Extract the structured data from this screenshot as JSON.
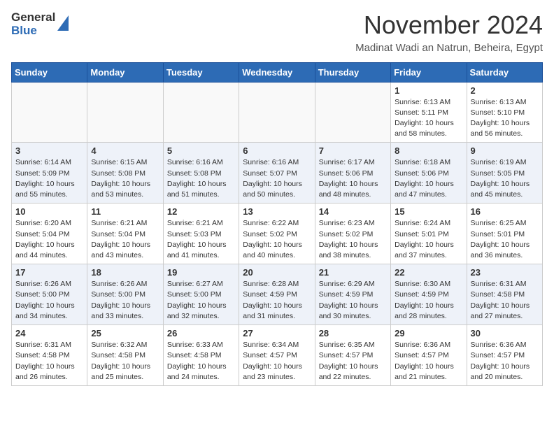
{
  "header": {
    "logo_general": "General",
    "logo_blue": "Blue",
    "month_title": "November 2024",
    "location": "Madinat Wadi an Natrun, Beheira, Egypt"
  },
  "days_of_week": [
    "Sunday",
    "Monday",
    "Tuesday",
    "Wednesday",
    "Thursday",
    "Friday",
    "Saturday"
  ],
  "weeks": [
    [
      {
        "day": "",
        "info": ""
      },
      {
        "day": "",
        "info": ""
      },
      {
        "day": "",
        "info": ""
      },
      {
        "day": "",
        "info": ""
      },
      {
        "day": "",
        "info": ""
      },
      {
        "day": "1",
        "info": "Sunrise: 6:13 AM\nSunset: 5:11 PM\nDaylight: 10 hours and 58 minutes."
      },
      {
        "day": "2",
        "info": "Sunrise: 6:13 AM\nSunset: 5:10 PM\nDaylight: 10 hours and 56 minutes."
      }
    ],
    [
      {
        "day": "3",
        "info": "Sunrise: 6:14 AM\nSunset: 5:09 PM\nDaylight: 10 hours and 55 minutes."
      },
      {
        "day": "4",
        "info": "Sunrise: 6:15 AM\nSunset: 5:08 PM\nDaylight: 10 hours and 53 minutes."
      },
      {
        "day": "5",
        "info": "Sunrise: 6:16 AM\nSunset: 5:08 PM\nDaylight: 10 hours and 51 minutes."
      },
      {
        "day": "6",
        "info": "Sunrise: 6:16 AM\nSunset: 5:07 PM\nDaylight: 10 hours and 50 minutes."
      },
      {
        "day": "7",
        "info": "Sunrise: 6:17 AM\nSunset: 5:06 PM\nDaylight: 10 hours and 48 minutes."
      },
      {
        "day": "8",
        "info": "Sunrise: 6:18 AM\nSunset: 5:06 PM\nDaylight: 10 hours and 47 minutes."
      },
      {
        "day": "9",
        "info": "Sunrise: 6:19 AM\nSunset: 5:05 PM\nDaylight: 10 hours and 45 minutes."
      }
    ],
    [
      {
        "day": "10",
        "info": "Sunrise: 6:20 AM\nSunset: 5:04 PM\nDaylight: 10 hours and 44 minutes."
      },
      {
        "day": "11",
        "info": "Sunrise: 6:21 AM\nSunset: 5:04 PM\nDaylight: 10 hours and 43 minutes."
      },
      {
        "day": "12",
        "info": "Sunrise: 6:21 AM\nSunset: 5:03 PM\nDaylight: 10 hours and 41 minutes."
      },
      {
        "day": "13",
        "info": "Sunrise: 6:22 AM\nSunset: 5:02 PM\nDaylight: 10 hours and 40 minutes."
      },
      {
        "day": "14",
        "info": "Sunrise: 6:23 AM\nSunset: 5:02 PM\nDaylight: 10 hours and 38 minutes."
      },
      {
        "day": "15",
        "info": "Sunrise: 6:24 AM\nSunset: 5:01 PM\nDaylight: 10 hours and 37 minutes."
      },
      {
        "day": "16",
        "info": "Sunrise: 6:25 AM\nSunset: 5:01 PM\nDaylight: 10 hours and 36 minutes."
      }
    ],
    [
      {
        "day": "17",
        "info": "Sunrise: 6:26 AM\nSunset: 5:00 PM\nDaylight: 10 hours and 34 minutes."
      },
      {
        "day": "18",
        "info": "Sunrise: 6:26 AM\nSunset: 5:00 PM\nDaylight: 10 hours and 33 minutes."
      },
      {
        "day": "19",
        "info": "Sunrise: 6:27 AM\nSunset: 5:00 PM\nDaylight: 10 hours and 32 minutes."
      },
      {
        "day": "20",
        "info": "Sunrise: 6:28 AM\nSunset: 4:59 PM\nDaylight: 10 hours and 31 minutes."
      },
      {
        "day": "21",
        "info": "Sunrise: 6:29 AM\nSunset: 4:59 PM\nDaylight: 10 hours and 30 minutes."
      },
      {
        "day": "22",
        "info": "Sunrise: 6:30 AM\nSunset: 4:59 PM\nDaylight: 10 hours and 28 minutes."
      },
      {
        "day": "23",
        "info": "Sunrise: 6:31 AM\nSunset: 4:58 PM\nDaylight: 10 hours and 27 minutes."
      }
    ],
    [
      {
        "day": "24",
        "info": "Sunrise: 6:31 AM\nSunset: 4:58 PM\nDaylight: 10 hours and 26 minutes."
      },
      {
        "day": "25",
        "info": "Sunrise: 6:32 AM\nSunset: 4:58 PM\nDaylight: 10 hours and 25 minutes."
      },
      {
        "day": "26",
        "info": "Sunrise: 6:33 AM\nSunset: 4:58 PM\nDaylight: 10 hours and 24 minutes."
      },
      {
        "day": "27",
        "info": "Sunrise: 6:34 AM\nSunset: 4:57 PM\nDaylight: 10 hours and 23 minutes."
      },
      {
        "day": "28",
        "info": "Sunrise: 6:35 AM\nSunset: 4:57 PM\nDaylight: 10 hours and 22 minutes."
      },
      {
        "day": "29",
        "info": "Sunrise: 6:36 AM\nSunset: 4:57 PM\nDaylight: 10 hours and 21 minutes."
      },
      {
        "day": "30",
        "info": "Sunrise: 6:36 AM\nSunset: 4:57 PM\nDaylight: 10 hours and 20 minutes."
      }
    ]
  ]
}
